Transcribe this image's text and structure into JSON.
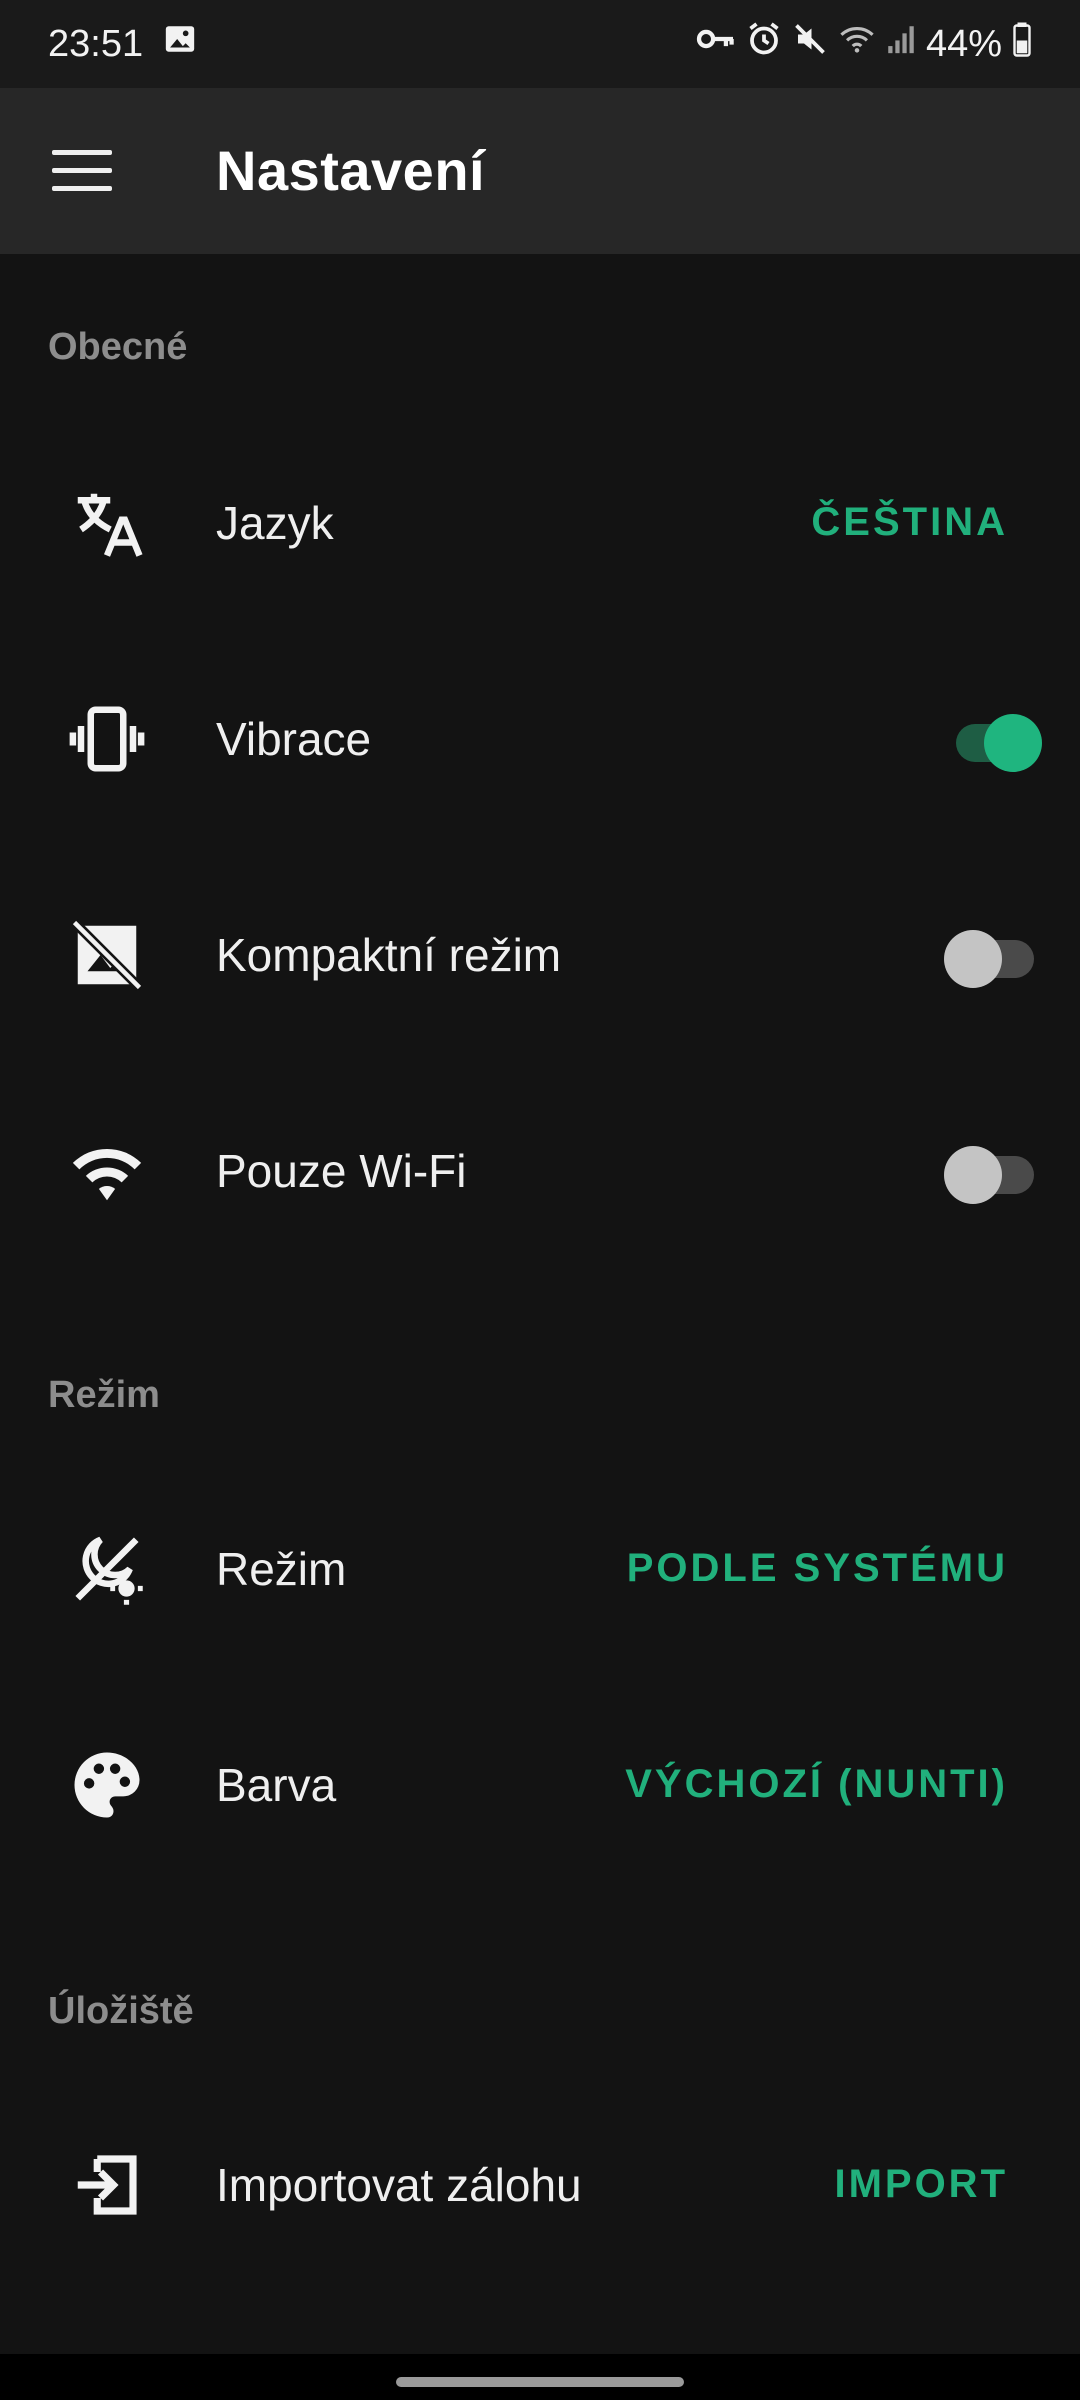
{
  "status_bar": {
    "time": "23:51",
    "battery": "44%",
    "icons": [
      "image-icon",
      "vpn-key-icon",
      "alarm-icon",
      "mute-icon",
      "wifi-icon",
      "signal-icon",
      "battery-icon"
    ]
  },
  "app_bar": {
    "title": "Nastavení",
    "menu_icon": "menu-icon"
  },
  "sections": [
    {
      "header": "Obecné",
      "items": [
        {
          "icon": "translate-icon",
          "label": "Jazyk",
          "value": "ČEŠTINA"
        },
        {
          "icon": "vibration-icon",
          "label": "Vibrace",
          "toggle": true
        },
        {
          "icon": "hide-image-icon",
          "label": "Kompaktní režim",
          "toggle": false
        },
        {
          "icon": "wifi-icon",
          "label": "Pouze Wi-Fi",
          "toggle": false
        }
      ]
    },
    {
      "header": "Režim",
      "items": [
        {
          "icon": "theme-mode-icon",
          "label": "Režim",
          "value": "PODLE SYSTÉMU"
        },
        {
          "icon": "palette-icon",
          "label": "Barva",
          "value": "VÝCHOZÍ (NUNTI)"
        }
      ]
    },
    {
      "header": "Úložiště",
      "items": [
        {
          "icon": "import-icon",
          "label": "Importovat zálohu",
          "value": "IMPORT"
        }
      ]
    }
  ],
  "colors": {
    "accent": "#21b07c",
    "background": "#131313",
    "app_bar": "#272727",
    "section_header": "#8d8d8d"
  }
}
